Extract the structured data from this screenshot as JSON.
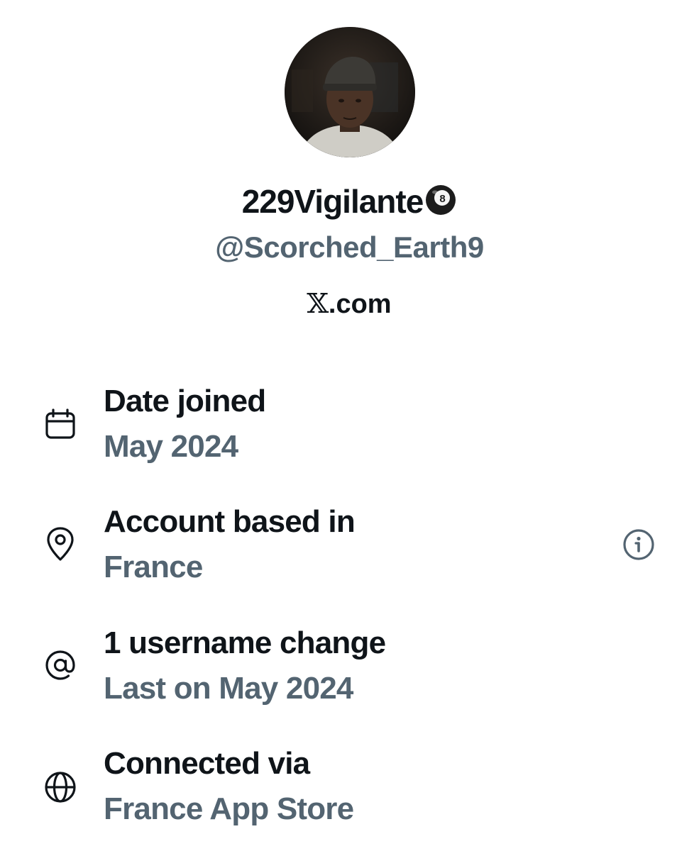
{
  "profile": {
    "display_name": "229Vigilante",
    "name_emoji": "pool-8-ball-emoji",
    "handle": "@Scorched_Earth9",
    "site_logo": "𝕏",
    "site_suffix": ".com"
  },
  "details": [
    {
      "icon": "calendar-icon",
      "title": "Date joined",
      "value": "May 2024"
    },
    {
      "icon": "location-pin-icon",
      "title": "Account based in",
      "value": "France",
      "has_info_button": true
    },
    {
      "icon": "at-sign-icon",
      "title": "1 username change",
      "value": "Last on May 2024"
    },
    {
      "icon": "globe-icon",
      "title": "Connected via",
      "value": "France App Store"
    }
  ],
  "colors": {
    "primary_text": "#0f1419",
    "secondary_text": "#536471",
    "background": "#ffffff"
  }
}
